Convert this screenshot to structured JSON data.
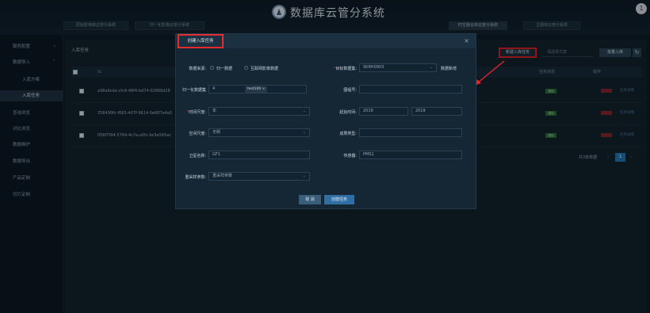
{
  "app": {
    "title": "数据库云管分系统",
    "user_initial": "1"
  },
  "top_tabs": [
    {
      "label": "原始影响库云管分系统",
      "active": false
    },
    {
      "label": "归一化影像云管分系统",
      "active": false
    },
    {
      "label": "时空融合库云管分系统",
      "active": true
    },
    {
      "label": "主题库云管分系统",
      "active": false
    }
  ],
  "sidebar": {
    "items": [
      {
        "label": "服务配置",
        "chevron": "›"
      },
      {
        "label": "数据导入",
        "chevron": "˄"
      },
      {
        "label": "入库方案"
      },
      {
        "label": "入库任务"
      },
      {
        "label": "查询浏览"
      },
      {
        "label": "对比浏览"
      },
      {
        "label": "数据维护"
      },
      {
        "label": "数据导出"
      },
      {
        "label": "产品定制"
      },
      {
        "label": "切片定制"
      }
    ]
  },
  "main": {
    "title": "入库任务",
    "new_task_label": "新建入库任务",
    "filter_placeholder": "请选择方案",
    "batch_label": "批量入库",
    "table": {
      "headers": {
        "id": "id",
        "status": "任务状态",
        "ops": "操作"
      },
      "rows": [
        {
          "id": "e98a9cde-cfc4-48f4-bd74-02666d28",
          "status": "成功",
          "op": "任务详情"
        },
        {
          "id": "256499fc-f663-407f-9614-0e687e4a5",
          "status": "成功",
          "op": "任务详情"
        },
        {
          "id": "056f7f94-5764-4c7a-a5fc-bc9e565ec",
          "status": "成功",
          "op": "任务详情"
        }
      ]
    },
    "pager": {
      "total": "共3条数据",
      "page": "1",
      "prev": "‹",
      "next": "›"
    }
  },
  "modal": {
    "title": "创建入库任务",
    "close": "×",
    "fields": {
      "source_label": "数据来源:",
      "source_opt1": "归一数据",
      "source_opt2": "互联网影像数据",
      "target_label": "目标数据集:",
      "target_value": "SKRH0903",
      "target_new": "数据新增",
      "norm_label": "归一化数据集",
      "norm_value": "4",
      "norm_tag": "test100 ×",
      "mapno_label": "图幅号:",
      "time_label": "时间尺度:",
      "time_value": "年",
      "start_label": "起始时间:",
      "start_value": "2019",
      "end_value": "2019",
      "space_label": "空间尺度:",
      "space_value": "无频",
      "product_label": "成果类型:",
      "sat_label": "卫星名称:",
      "sat_value": "GF1",
      "sensor_label": "传感器:",
      "sensor_value": "PMS1",
      "resample_label": "重采样参数:",
      "resample_placeholder": "重采样参数",
      "dropdown_arrow": "⌄"
    },
    "cancel_label": "取 消",
    "create_label": "创建任务"
  },
  "colors": {
    "accent": "#2f6fa3",
    "highlight_red": "#e0252e",
    "status_green": "#2e6d3c"
  }
}
